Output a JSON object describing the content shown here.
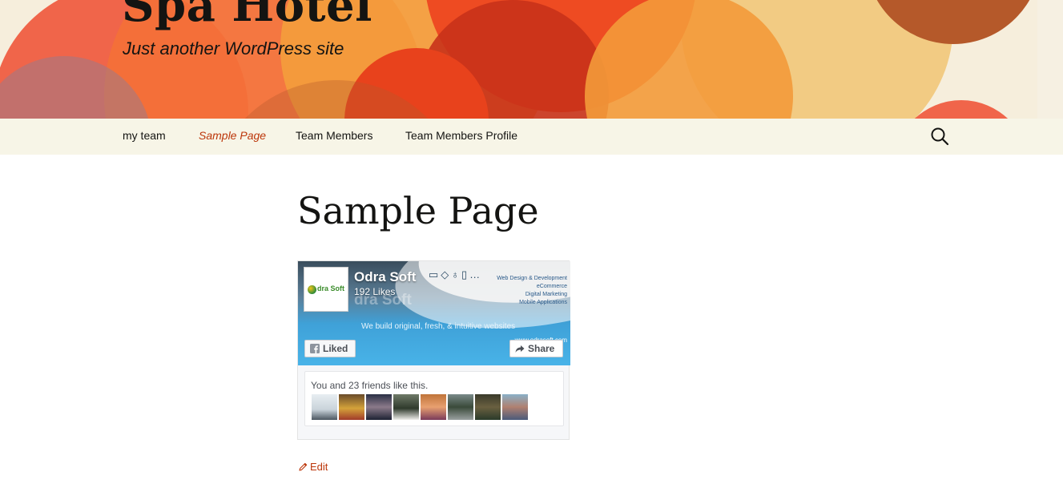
{
  "site": {
    "title": "Spa Hotel",
    "description": "Just another WordPress site"
  },
  "nav": {
    "items": [
      {
        "label": "my team",
        "current": false
      },
      {
        "label": "Sample Page",
        "current": true
      },
      {
        "label": "Team Members",
        "current": false
      },
      {
        "label": "Team Members Profile",
        "current": false
      }
    ],
    "search_icon": "search-icon"
  },
  "page": {
    "title": "Sample Page",
    "edit_label": "Edit"
  },
  "facebook_widget": {
    "page_name": "Odra Soft",
    "likes": "192 Likes",
    "logo_text": "dra Soft",
    "cover_ghost_text": "dra Soft",
    "services": [
      "Web Design & Development",
      "eCommerce",
      "Digital Marketing",
      "Mobile Applications"
    ],
    "tagline": "We build original, fresh, & intuitive websites",
    "url": "www.odrasoft.com",
    "liked_label": "Liked",
    "share_label": "Share",
    "friends_text": "You and 23 friends like this.",
    "friend_avatar_count": 8
  },
  "colors": {
    "accent": "#bc360a",
    "nav_bg": "#f7f5e7",
    "text": "#141412"
  }
}
